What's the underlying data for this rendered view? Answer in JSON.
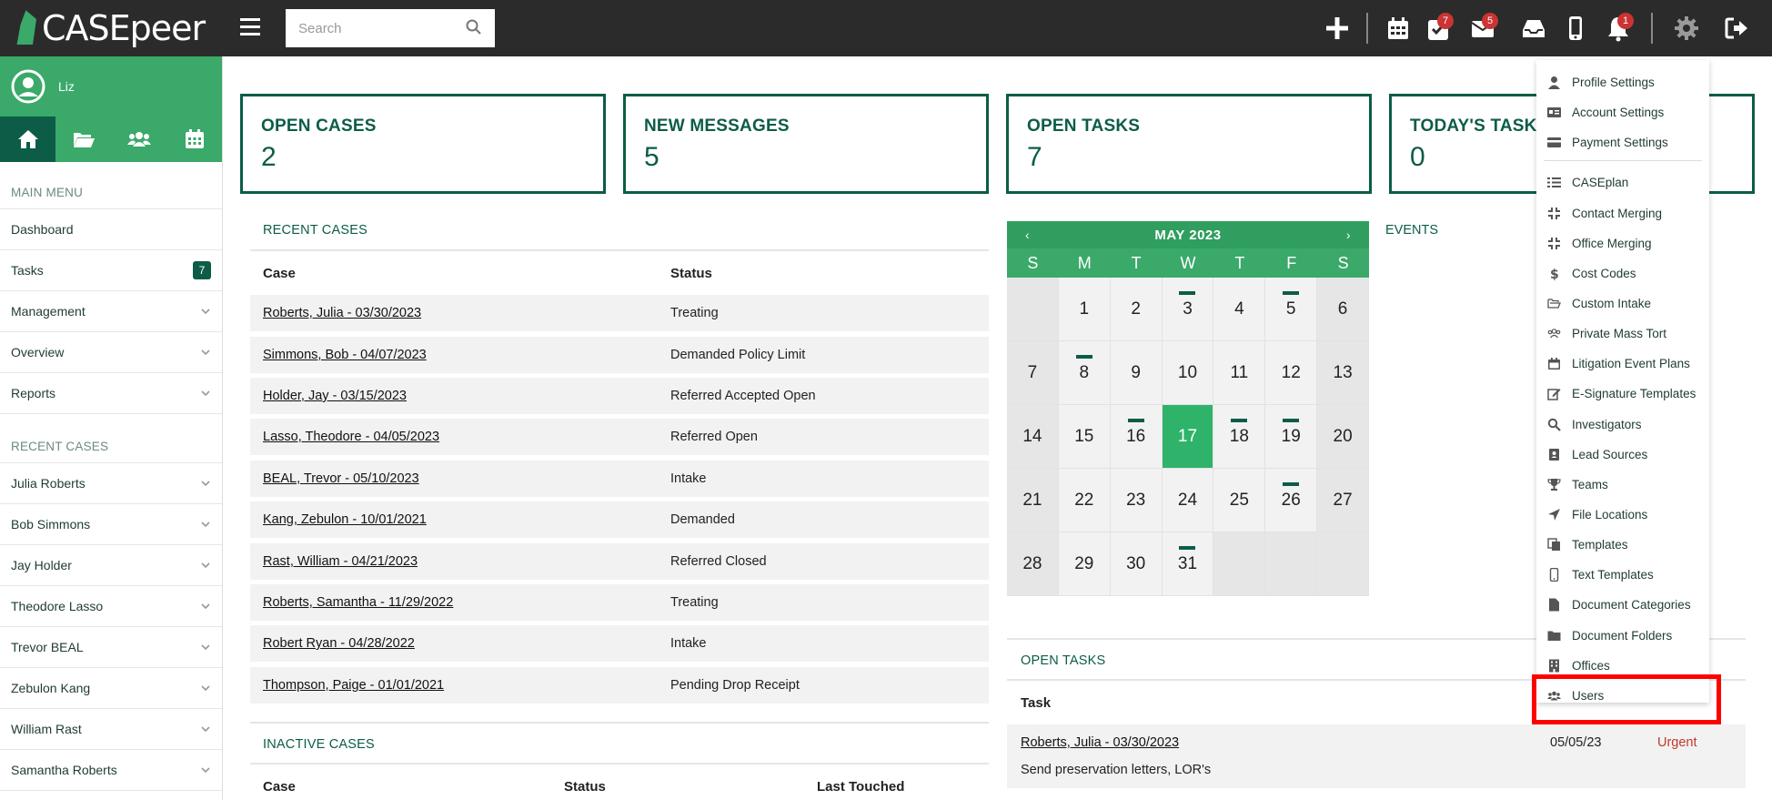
{
  "app": {
    "brand": "CASEpeer",
    "accent": "#0c5c48",
    "sidebar_green": "#3aa96a",
    "topbar": "#2b2b2b"
  },
  "search": {
    "placeholder": "Search"
  },
  "topbar": {
    "icons": [
      "plus-icon",
      "calendar-icon",
      "tasks-icon",
      "mail-icon",
      "inbox-icon",
      "phone-icon",
      "bell-icon",
      "gear-icon",
      "logout-icon"
    ],
    "badges": {
      "tasks": "7",
      "mail": "5",
      "bell": "1"
    }
  },
  "sidebar": {
    "user": "Liz",
    "tabs": [
      "home-icon",
      "folder-icon",
      "users-icon",
      "calendar-icon"
    ],
    "main_menu_header": "MAIN MENU",
    "main_menu": [
      {
        "label": "Dashboard"
      },
      {
        "label": "Tasks",
        "badge": "7"
      },
      {
        "label": "Management"
      },
      {
        "label": "Overview"
      },
      {
        "label": "Reports"
      }
    ],
    "recent_header": "RECENT CASES",
    "recent": [
      "Julia Roberts",
      "Bob Simmons",
      "Jay Holder",
      "Theodore Lasso",
      "Trevor BEAL",
      "Zebulon Kang",
      "William Rast",
      "Samantha Roberts"
    ]
  },
  "stats": [
    {
      "label": "OPEN CASES",
      "value": "2"
    },
    {
      "label": "NEW MESSAGES",
      "value": "5"
    },
    {
      "label": "OPEN TASKS",
      "value": "7"
    },
    {
      "label": "TODAY'S TASKS",
      "value": "0"
    }
  ],
  "recent_cases": {
    "title": "RECENT CASES",
    "headers": [
      "Case",
      "Status"
    ],
    "rows": [
      {
        "name": "Roberts, Julia - 03/30/2023",
        "status": "Treating"
      },
      {
        "name": "Simmons, Bob - 04/07/2023",
        "status": "Demanded Policy Limit"
      },
      {
        "name": "Holder, Jay - 03/15/2023",
        "status": "Referred Accepted Open"
      },
      {
        "name": "Lasso, Theodore - 04/05/2023",
        "status": "Referred Open"
      },
      {
        "name": "BEAL, Trevor - 05/10/2023",
        "status": "Intake"
      },
      {
        "name": "Kang, Zebulon - 10/01/2021",
        "status": "Demanded"
      },
      {
        "name": "Rast, William - 04/21/2023",
        "status": "Referred Closed"
      },
      {
        "name": "Roberts, Samantha - 11/29/2022",
        "status": "Treating"
      },
      {
        "name": "Robert Ryan - 04/28/2022",
        "status": "Intake"
      },
      {
        "name": "Thompson, Paige - 01/01/2021",
        "status": "Pending Drop Receipt"
      }
    ]
  },
  "inactive_cases": {
    "title": "INACTIVE CASES",
    "headers": [
      "Case",
      "Status",
      "Last Touched"
    ]
  },
  "calendar": {
    "prev": "‹",
    "next": "›",
    "month": "MAY 2023",
    "dow": [
      "S",
      "M",
      "T",
      "W",
      "T",
      "F",
      "S"
    ],
    "days": [
      "",
      "1",
      "2",
      "3",
      "4",
      "5",
      "6",
      "7",
      "8",
      "9",
      "10",
      "11",
      "12",
      "13",
      "14",
      "15",
      "16",
      "17",
      "18",
      "19",
      "20",
      "21",
      "22",
      "23",
      "24",
      "25",
      "26",
      "27",
      "28",
      "29",
      "30",
      "31",
      "",
      "",
      ""
    ],
    "today": "17",
    "marked": [
      "3",
      "5",
      "8",
      "16",
      "18",
      "19",
      "26",
      "31"
    ]
  },
  "events": {
    "title": "EVENTS"
  },
  "open_tasks": {
    "title": "OPEN TASKS",
    "header": "Task",
    "rows": [
      {
        "case": "Roberts, Julia - 03/30/2023",
        "desc": "Send preservation letters, LOR's",
        "date": "05/05/23",
        "priority": "Urgent"
      }
    ]
  },
  "settings_menu": {
    "items": [
      {
        "label": "Profile Settings",
        "icon": "user-icon"
      },
      {
        "label": "Account Settings",
        "icon": "id-card-icon"
      },
      {
        "label": "Payment Settings",
        "icon": "credit-card-icon"
      },
      {
        "label": "CASEplan",
        "icon": "list-icon"
      },
      {
        "label": "Contact Merging",
        "icon": "compress-icon"
      },
      {
        "label": "Office Merging",
        "icon": "compress-icon"
      },
      {
        "label": "Cost Codes",
        "icon": "dollar-icon"
      },
      {
        "label": "Custom Intake",
        "icon": "folder-open-icon"
      },
      {
        "label": "Private Mass Tort",
        "icon": "users-icon"
      },
      {
        "label": "Litigation Event Plans",
        "icon": "calendar-icon"
      },
      {
        "label": "E-Signature Templates",
        "icon": "edit-icon"
      },
      {
        "label": "Investigators",
        "icon": "search-icon"
      },
      {
        "label": "Lead Sources",
        "icon": "contact-book-icon"
      },
      {
        "label": "Teams",
        "icon": "trophy-icon"
      },
      {
        "label": "File Locations",
        "icon": "location-arrow-icon"
      },
      {
        "label": "Templates",
        "icon": "copy-icon"
      },
      {
        "label": "Text Templates",
        "icon": "mobile-icon"
      },
      {
        "label": "Document Categories",
        "icon": "file-icon"
      },
      {
        "label": "Document Folders",
        "icon": "folder-icon"
      },
      {
        "label": "Offices",
        "icon": "building-icon"
      },
      {
        "label": "Users",
        "icon": "users-icon"
      }
    ]
  }
}
